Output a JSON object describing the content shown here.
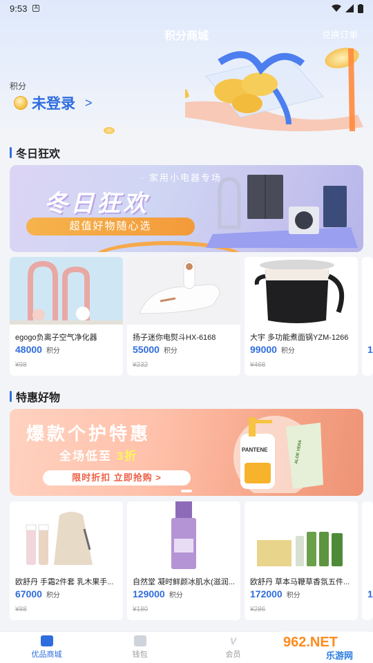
{
  "status_bar": {
    "time": "9:53",
    "app_icon": "A"
  },
  "header": {
    "title": "积分商城",
    "order_link": "兑换订单"
  },
  "points": {
    "label": "积分",
    "login_text": "未登录",
    "chevron": ">"
  },
  "section1": {
    "title": "冬日狂欢",
    "banner": {
      "tag": "· 家用小电器专场 ·",
      "headline": "冬日狂欢",
      "pill": "超值好物随心选"
    },
    "products": [
      {
        "name": "egogo负离子空气净化器",
        "points": "48000",
        "unit": "积分",
        "price": "¥98"
      },
      {
        "name": "扬子迷你电熨斗HX-6168",
        "points": "55000",
        "unit": "积分",
        "price": "¥232"
      },
      {
        "name": "大宇 多功能煮面锅YZM-1266",
        "points": "99000",
        "unit": "积分",
        "price": "¥468"
      }
    ],
    "partial_points": "1"
  },
  "section2": {
    "title": "特惠好物",
    "banner": {
      "headline": "爆款个护特惠",
      "sub_prefix": "全场低至",
      "sub_highlight": "3折",
      "pill": "限时折扣 立即抢购 >",
      "brand1": "PANTENE",
      "brand2": "ALOE VERA"
    },
    "products": [
      {
        "name": "欧舒丹 手霜2件套 乳木果手...",
        "points": "67000",
        "unit": "积分",
        "price": "¥88"
      },
      {
        "name": "自然堂 凝时鲜颜冰肌水(滋润...",
        "points": "129000",
        "unit": "积分",
        "price": "¥180"
      },
      {
        "name": "欧舒丹 草本马鞭草香氛五件...",
        "points": "172000",
        "unit": "积分",
        "price": "¥286"
      }
    ],
    "partial_points": "1"
  },
  "bottom_nav": [
    {
      "label": "优品商城",
      "active": true
    },
    {
      "label": "钱包",
      "active": false
    },
    {
      "label": "会员",
      "active": false
    }
  ],
  "watermark": {
    "brand": "962.NET",
    "sub": "乐游网"
  },
  "colors": {
    "accent": "#2f6dde",
    "banner1": "#cfd6f3",
    "banner2": "#ffc1ab"
  }
}
